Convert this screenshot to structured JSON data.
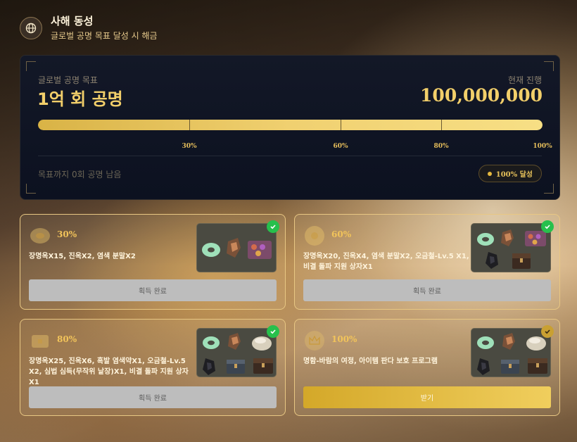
{
  "header": {
    "title": "사해 동성",
    "subtitle": "글로벌 공명 목표 달성 시 해금",
    "icon": "globe-icon"
  },
  "goal": {
    "label": "글로벌 공명 목표",
    "title": "1억 회 공명",
    "progress_label": "현재 진행",
    "progress_value": "100,000,000",
    "progress_fraction": 1.0,
    "milestones": [
      "30%",
      "60%",
      "80%",
      "100%"
    ],
    "remaining_text": "목표까지 0회 공명 남음",
    "badge": "100% 달성"
  },
  "colors": {
    "gold": "#f2cf6a",
    "done_check": "#27c04c",
    "claim_check": "#c9a032",
    "done_button": "#bdbdbd"
  },
  "cards": [
    {
      "percent": "30%",
      "description": "장명옥X15, 진옥X2, 염색 분말X2",
      "button": "획득 완료",
      "status": "completed",
      "reward_icons": [
        "jade-ring-icon",
        "ore-icon",
        "dye-box-icon"
      ]
    },
    {
      "percent": "60%",
      "description": "장명옥X20, 진옥X4, 염색 분말X2, 오금철-Lv.5 X1, 비결 돌파 지원 상자X1",
      "button": "획득 완료",
      "status": "completed",
      "reward_icons": [
        "jade-ring-icon",
        "ore-icon",
        "dye-box-icon",
        "black-stone-icon",
        "chest-icon"
      ]
    },
    {
      "percent": "80%",
      "description": "장명옥X25, 진옥X6, 흑발 염색약X1, 오금철-Lv.5 X2, 심법 심득(무작위 낱장)X1, 비결 돌파 지원 상자X1",
      "button": "획득 완료",
      "status": "completed",
      "reward_icons": [
        "jade-ring-icon",
        "ore-icon",
        "pouch-icon",
        "black-stone-icon",
        "chest-icon",
        "chest-icon"
      ]
    },
    {
      "percent": "100%",
      "description": "명함-바람의 여정, 아이템 판다 보호 프로그램",
      "button": "받기",
      "status": "claimable",
      "reward_icons": [
        "jade-ring-icon",
        "ore-icon",
        "pouch-icon",
        "black-stone-icon",
        "chest-icon",
        "chest-icon"
      ]
    }
  ]
}
